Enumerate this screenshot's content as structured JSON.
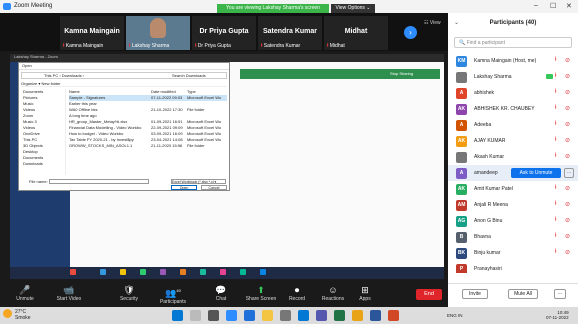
{
  "window": {
    "title": "Zoom Meeting"
  },
  "banner": {
    "share_text": "You are viewing Lakshay Sharma's screen",
    "view_options": "View Options ⌄"
  },
  "window_controls": {
    "minimize": "–",
    "maximize": "☐",
    "close": "✕"
  },
  "videos": [
    {
      "name": "Kamna Maingain",
      "label": "Kamna Maingain"
    },
    {
      "name": "",
      "label": "Lakshay Sharma"
    },
    {
      "name": "Dr Priya Gupta",
      "label": "Dr Priya Gupta"
    },
    {
      "name": "Satendra Kumar",
      "label": "Satendra Kumar"
    },
    {
      "name": "Midhat",
      "label": "Midhat"
    }
  ],
  "view_btn": "☷ View",
  "shared_screen": {
    "title": "Lakshay Sharma - Zoom",
    "greenbar_text": "Stop Sharing",
    "dialog": {
      "title": "Open",
      "address": "This PC › Downloads ›",
      "search_placeholder": "Search Downloads",
      "organize": "Organize ▾   New folder",
      "nav_items": [
        "Documents",
        "Pictures",
        "Music",
        "Videos",
        "Zoom",
        "Music 3",
        "Videos",
        "OneDrive",
        "This PC",
        "3D Objects",
        "Desktop",
        "Documents",
        "Downloads"
      ],
      "columns": [
        "Name",
        "Date modified",
        "Type"
      ],
      "files": [
        {
          "name": "Sample - Signatures",
          "date": "07-11-2022 09:03",
          "type": "Microsoft Excel Wo"
        },
        {
          "name": "Earlier this year",
          "date": "",
          "type": ""
        },
        {
          "name": "WA0 Offline bks",
          "date": "21-10-2022 17:30",
          "type": "File folder"
        },
        {
          "name": "A long time ago",
          "date": "",
          "type": ""
        },
        {
          "name": "HR_group_Master_Metay%i.xlsx",
          "date": "01-09-2021 16:51",
          "type": "Microsoft Excel Wo"
        },
        {
          "name": "Financial Data Modelling - Video Workbo",
          "date": "22-09-2021 09:09",
          "type": "Microsoft Excel Wo"
        },
        {
          "name": "How to budget - Video Workbo",
          "date": "03-09-2021 16:09",
          "type": "Microsoft Excel Wo"
        },
        {
          "name": "Tax Table FY 2020-21 - by Invest$py",
          "date": "23-04-2021 14:08",
          "type": "Microsoft Excel Wo"
        },
        {
          "name": "GROWW_STOCKS_MIN_ASOL1.1",
          "date": "21-11-2020 15:56",
          "type": "File folder"
        }
      ],
      "filename_label": "File name:",
      "filetype": "Excel Workbook (*.xlsx *.xl ▾",
      "open": "Open",
      "cancel": "Cancel"
    }
  },
  "toolbar": [
    {
      "icon": "🎤",
      "label": "Unmute"
    },
    {
      "icon": "📹",
      "label": "Start Video"
    },
    {
      "icon": "🛡",
      "label": "Security"
    },
    {
      "icon": "👥",
      "label": "Participants"
    },
    {
      "icon": "💬",
      "label": "Chat"
    },
    {
      "icon": "⬆",
      "label": "Share Screen"
    },
    {
      "icon": "⏺",
      "label": "Record"
    },
    {
      "icon": "☺",
      "label": "Reactions"
    },
    {
      "icon": "⊞",
      "label": "Apps"
    }
  ],
  "participants_count_badge": "40",
  "end_button": "End",
  "panel": {
    "title": "Participants (40)",
    "search_placeholder": "Find a participant",
    "participants": [
      {
        "initials": "KM",
        "name": "Kamna Maingain (Host, me)",
        "color": "#2e86de"
      },
      {
        "initials": "",
        "name": "Lakshay Sharma",
        "color": "#777777"
      },
      {
        "initials": "A",
        "name": "abhishek",
        "color": "#e0452a"
      },
      {
        "initials": "AK",
        "name": "ABHISHEK KR. CHAUBEY",
        "color": "#8e44ad"
      },
      {
        "initials": "A",
        "name": "Adeeba",
        "color": "#d35400"
      },
      {
        "initials": "AK",
        "name": "AJAY KUMAR",
        "color": "#f39c12"
      },
      {
        "initials": "",
        "name": "Akash Kumar",
        "color": "#777777"
      },
      {
        "initials": "A",
        "name": "amandeep",
        "color": "#7d5cc6"
      },
      {
        "initials": "AK",
        "name": "Amit Kumar Patel",
        "color": "#27ae60"
      },
      {
        "initials": "AM",
        "name": "Anjali R Meena",
        "color": "#c0392b"
      },
      {
        "initials": "AG",
        "name": "Anon G Binu",
        "color": "#16a085"
      },
      {
        "initials": "B",
        "name": "Bhavna",
        "color": "#555f6d"
      },
      {
        "initials": "BK",
        "name": "Binju kumar",
        "color": "#2e4a7d"
      },
      {
        "initials": "P",
        "name": "Pranayhasiri",
        "color": "#c0392b"
      }
    ],
    "unmute_button": "Ask to Unmute",
    "more_button": "···",
    "invite": "Invite",
    "mute_all": "Mute All",
    "footer_more": "···"
  },
  "taskbar": {
    "temp": "27°C",
    "weather": "Smoke",
    "tray_text": "ENG IN",
    "time": "10:49",
    "date": "07-11-2022"
  }
}
